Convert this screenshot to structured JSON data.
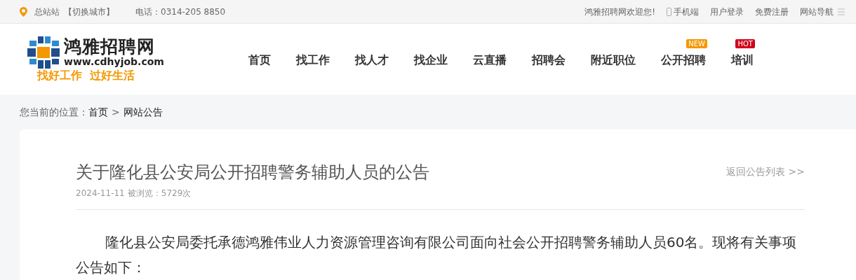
{
  "top_bar": {
    "station": "总站站",
    "switch_city": "【切换城市】",
    "phone": "电话：0314-205 8850",
    "welcome": "鸿雅招聘网欢迎您!",
    "links": [
      {
        "label": "手机端",
        "kind": "mobile"
      },
      {
        "label": "用户登录",
        "kind": "plain"
      },
      {
        "label": "免费注册",
        "kind": "plain"
      },
      {
        "label": "网站导航",
        "kind": "menu"
      }
    ]
  },
  "logo": {
    "name": "鸿雅招聘网",
    "url": "www.cdhyjob.com",
    "slogan": "找好工作  过好生活"
  },
  "nav": [
    {
      "label": "首页"
    },
    {
      "label": "找工作"
    },
    {
      "label": "找人才"
    },
    {
      "label": "找企业"
    },
    {
      "label": "云直播"
    },
    {
      "label": "招聘会"
    },
    {
      "label": "附近职位"
    },
    {
      "label": "公开招聘",
      "badge": {
        "label": "NEW",
        "color": "#f39800"
      }
    },
    {
      "label": "培训",
      "badge": {
        "label": "HOT",
        "color": "#d0021b"
      }
    }
  ],
  "breadcrumb": {
    "prefix": "您当前的位置：",
    "items": [
      "首页",
      "网站公告"
    ],
    "separator": ">"
  },
  "article": {
    "title": "关于隆化县公安局公开招聘警务辅助人员的公告",
    "back_link": "返回公告列表 >>",
    "date": "2024-11-11",
    "views": "被浏览：5729次",
    "body": "隆化县公安局委托承德鸿雅伟业人力资源管理咨询有限公司面向社会公开招聘警务辅助人员60名。现将有关事项公告如下："
  }
}
